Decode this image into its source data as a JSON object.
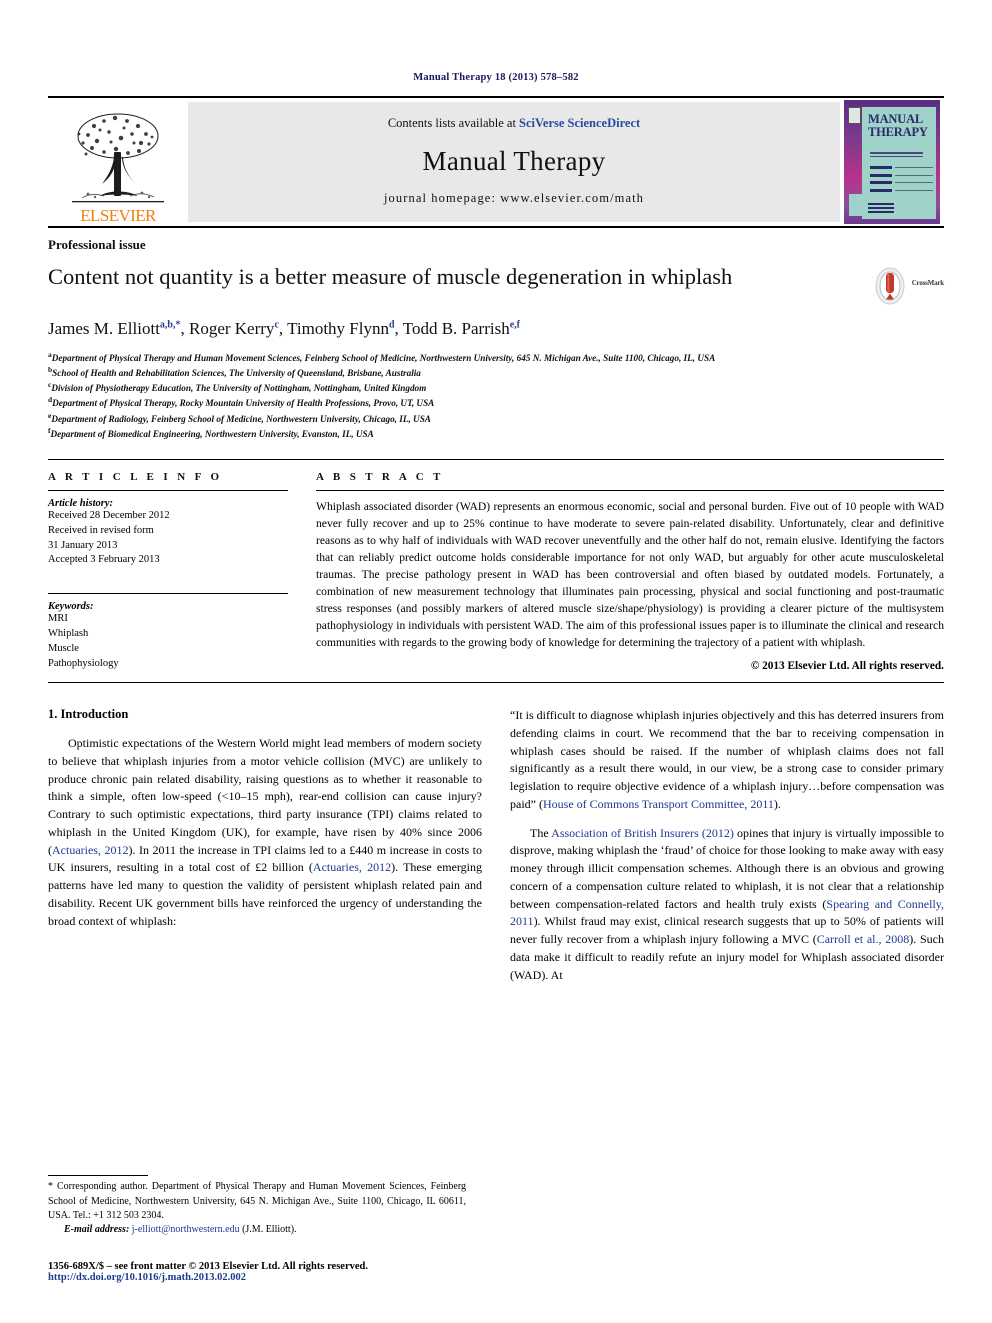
{
  "running_head": "Manual Therapy 18 (2013) 578–582",
  "masthead": {
    "publisher_wordmark": "ELSEVIER",
    "publisher_logo_icon": "elsevier-tree-icon",
    "contents_prefix": "Contents lists available at ",
    "contents_brand": "SciVerse ScienceDirect",
    "journal_name": "Manual Therapy",
    "homepage": "journal homepage: www.elsevier.com/math",
    "cover": {
      "title_line1": "MANUAL",
      "title_line2": "THERAPY",
      "badge_icon": "journal-seal-icon"
    }
  },
  "article": {
    "section_type": "Professional issue",
    "title": "Content not quantity is a better measure of muscle degeneration in whiplash",
    "crossmark_label": "CrossMark",
    "crossmark_icon": "crossmark-badge-icon",
    "authors": [
      {
        "name": "James M. Elliott",
        "marks": "a,b,*"
      },
      {
        "name": "Roger Kerry",
        "marks": "c"
      },
      {
        "name": "Timothy Flynn",
        "marks": "d"
      },
      {
        "name": "Todd B. Parrish",
        "marks": "e,f"
      }
    ],
    "affiliations": [
      {
        "mark": "a",
        "text": "Department of Physical Therapy and Human Movement Sciences, Feinberg School of Medicine, Northwestern University, 645 N. Michigan Ave., Suite 1100, Chicago, IL, USA"
      },
      {
        "mark": "b",
        "text": "School of Health and Rehabilitation Sciences, The University of Queensland, Brisbane, Australia"
      },
      {
        "mark": "c",
        "text": "Division of Physiotherapy Education, The University of Nottingham, Nottingham, United Kingdom"
      },
      {
        "mark": "d",
        "text": "Department of Physical Therapy, Rocky Mountain University of Health Professions, Provo, UT, USA"
      },
      {
        "mark": "e",
        "text": "Department of Radiology, Feinberg School of Medicine, Northwestern University, Chicago, IL, USA"
      },
      {
        "mark": "f",
        "text": "Department of Biomedical Engineering, Northwestern University, Evanston, IL, USA"
      }
    ]
  },
  "article_info": {
    "heading": "A R T I C L E  I N F O",
    "history_label": "Article history:",
    "history": [
      "Received 28 December 2012",
      "Received in revised form",
      "31 January 2013",
      "Accepted 3 February 2013"
    ],
    "keywords_label": "Keywords:",
    "keywords": [
      "MRI",
      "Whiplash",
      "Muscle",
      "Pathophysiology"
    ]
  },
  "abstract": {
    "heading": "A B S T R A C T",
    "text": "Whiplash associated disorder (WAD) represents an enormous economic, social and personal burden. Five out of 10 people with WAD never fully recover and up to 25% continue to have moderate to severe pain-related disability. Unfortunately, clear and definitive reasons as to why half of individuals with WAD recover uneventfully and the other half do not, remain elusive. Identifying the factors that can reliably predict outcome holds considerable importance for not only WAD, but arguably for other acute musculoskeletal traumas. The precise pathology present in WAD has been controversial and often biased by outdated models. Fortunately, a combination of new measurement technology that illuminates pain processing, physical and social functioning and post-traumatic stress responses (and possibly markers of altered muscle size/shape/physiology) is providing a clearer picture of the multisystem pathophysiology in individuals with persistent WAD. The aim of this professional issues paper is to illuminate the clinical and research communities with regards to the growing body of knowledge for determining the trajectory of a patient with whiplash.",
    "copyright": "© 2013 Elsevier Ltd. All rights reserved."
  },
  "body": {
    "section_heading": "1. Introduction",
    "left_para_1_a": "Optimistic expectations of the Western World might lead members of modern society to believe that whiplash injuries from a motor vehicle collision (MVC) are unlikely to produce chronic pain related disability, raising questions as to whether it reasonable to think a simple, often low-speed (<10–15 mph), rear-end collision can cause injury? Contrary to such optimistic expectations, third party insurance (TPI) claims related to whiplash in the United Kingdom (UK), for example, have risen by 40% since 2006 (",
    "ref_actuaries_1": "Actuaries, 2012",
    "left_para_1_b": "). In 2011 the increase in TPI claims led to a £440 m increase in costs to UK insurers, resulting in a total cost of £2 billion (",
    "ref_actuaries_2": "Actuaries, 2012",
    "left_para_1_c": "). These emerging patterns have led many to question the validity of persistent whiplash related pain and disability. Recent UK government bills have reinforced the urgency of understanding the broad context of whiplash:",
    "right_quote_a": "“It is difficult to diagnose whiplash injuries objectively and this has deterred insurers from defending claims in court. We recommend that the bar to receiving compensation in whiplash cases should be raised. If the number of whiplash claims does not fall significantly as a result there would, in our view, be a strong case to consider primary legislation to require objective evidence of a whiplash injury…before compensation was paid” (",
    "ref_house_commons": "House of Commons Transport Committee, 2011",
    "right_quote_b": ").",
    "right_para_2_a": "The ",
    "ref_abi": "Association of British Insurers (2012)",
    "right_para_2_b": " opines that injury is virtually impossible to disprove, making whiplash the ‘fraud’ of choice for those looking to make away with easy money through illicit compensation schemes. Although there is an obvious and growing concern of a compensation culture related to whiplash, it is not clear that a relationship between compensation-related factors and health truly exists (",
    "ref_spearing": "Spearing and Connelly, 2011",
    "right_para_2_c": "). Whilst fraud may exist, clinical research suggests that up to 50% of patients will never fully recover from a whiplash injury following a MVC (",
    "ref_carroll": "Carroll et al., 2008",
    "right_para_2_d": "). Such data make it difficult to readily refute an injury model for Whiplash associated disorder (WAD). At"
  },
  "footnote": {
    "star": "*",
    "text": " Corresponding author. Department of Physical Therapy and Human Movement Sciences, Feinberg School of Medicine, Northwestern University, 645 N. Michigan Ave., Suite 1100, Chicago, IL 60611, USA. Tel.: +1 312 503 2304.",
    "email_label": "E-mail address:",
    "email": "j-elliott@northwestern.edu",
    "email_owner": "(J.M. Elliott)."
  },
  "footer": {
    "line1": "1356-689X/$ – see front matter © 2013 Elsevier Ltd. All rights reserved.",
    "line2": "http://dx.doi.org/10.1016/j.math.2013.02.002"
  },
  "colors": {
    "elsevier_orange": "#f07f13",
    "link_blue": "#1e3a8f",
    "brand_blue": "#2a4b9b",
    "runhead_navy": "#1a1a5e",
    "banner_grey": "#e8e8e8",
    "cover_teal": "#9fd2c8",
    "crossmark_red": "#c0392b"
  }
}
